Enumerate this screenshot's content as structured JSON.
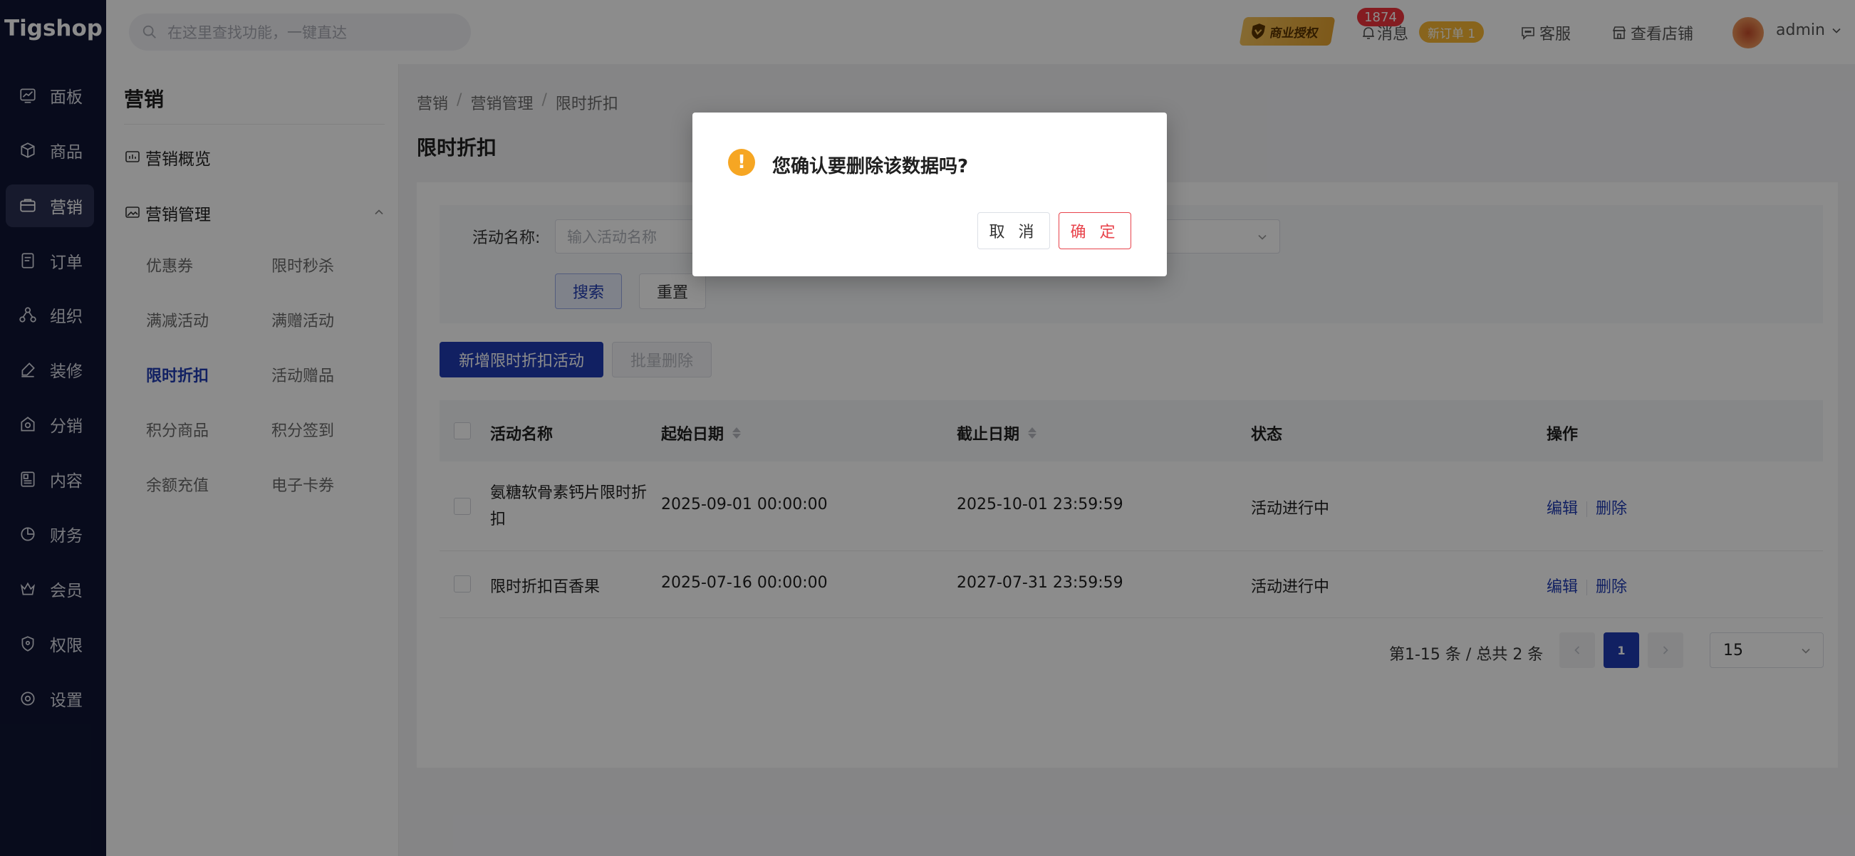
{
  "app": {
    "logo": "Tigshop"
  },
  "nav": {
    "items": [
      {
        "label": "面板",
        "icon": "dashboard-icon"
      },
      {
        "label": "商品",
        "icon": "box-icon"
      },
      {
        "label": "营销",
        "icon": "marketing-icon",
        "active": true
      },
      {
        "label": "订单",
        "icon": "order-icon"
      },
      {
        "label": "组织",
        "icon": "org-icon"
      },
      {
        "label": "装修",
        "icon": "brush-icon"
      },
      {
        "label": "分销",
        "icon": "distribution-icon"
      },
      {
        "label": "内容",
        "icon": "content-icon"
      },
      {
        "label": "财务",
        "icon": "finance-icon"
      },
      {
        "label": "会员",
        "icon": "member-icon"
      },
      {
        "label": "权限",
        "icon": "permission-icon"
      },
      {
        "label": "设置",
        "icon": "settings-icon"
      }
    ]
  },
  "header": {
    "search_placeholder": "在这里查找功能，一键直达",
    "license_label": "商业授权",
    "message_label": "消息",
    "message_count": "1874",
    "new_order_label": "新订单 1",
    "service_label": "客服",
    "view_store_label": "查看店铺",
    "user_name": "admin"
  },
  "subnav": {
    "title": "营销",
    "overview_label": "营销概览",
    "group_label": "营销管理",
    "items": [
      {
        "label": "优惠券"
      },
      {
        "label": "限时秒杀"
      },
      {
        "label": "满减活动"
      },
      {
        "label": "满赠活动"
      },
      {
        "label": "限时折扣",
        "active": true
      },
      {
        "label": "活动赠品"
      },
      {
        "label": "积分商品"
      },
      {
        "label": "积分签到"
      },
      {
        "label": "余额充值"
      },
      {
        "label": "电子卡券"
      }
    ]
  },
  "breadcrumb": [
    "营销",
    "管理",
    "限时折扣"
  ],
  "breadcrumb_full": {
    "a": "营销",
    "b": "营销管理",
    "c": "限时折扣",
    "sep": "/"
  },
  "page": {
    "title": "限时折扣"
  },
  "filter": {
    "name_label": "活动名称:",
    "name_placeholder": "输入活动名称",
    "search_label": "搜索",
    "reset_label": "重置"
  },
  "actions": {
    "new_label": "新增限时折扣活动",
    "batch_delete_label": "批量删除"
  },
  "table": {
    "columns": [
      "活动名称",
      "起始日期",
      "截止日期",
      "状态",
      "操作"
    ],
    "rows": [
      {
        "name": "氨糖软骨素钙片限时折扣",
        "start": "2025-09-01 00:00:00",
        "end": "2025-10-01 23:59:59",
        "status": "活动进行中",
        "edit": "编辑",
        "delete": "删除"
      },
      {
        "name": "限时折扣百香果",
        "start": "2025-07-16 00:00:00",
        "end": "2027-07-31 23:59:59",
        "status": "活动进行中",
        "edit": "编辑",
        "delete": "删除"
      }
    ]
  },
  "pagination": {
    "summary": "第1-15 条 / 总共 2 条",
    "current_page": "1",
    "page_size": "15"
  },
  "modal": {
    "message": "您确认要删除该数据吗?",
    "cancel_label": "取 消",
    "ok_label": "确 定"
  },
  "colors": {
    "primary": "#1f3bb3",
    "nav_bg": "#0f1533",
    "danger": "#e8434b",
    "warning": "#f6a623"
  }
}
